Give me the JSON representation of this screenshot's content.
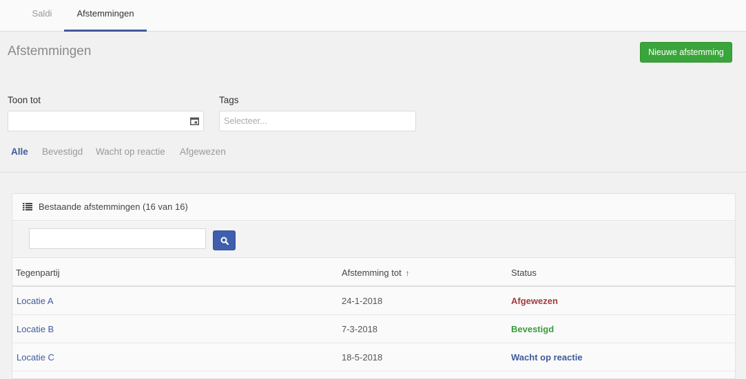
{
  "tabs": [
    {
      "label": "Saldi",
      "active": false
    },
    {
      "label": "Afstemmingen",
      "active": true
    }
  ],
  "header": {
    "title": "Afstemmingen",
    "new_button_label": "Nieuwe afstemming",
    "accent_color": "#3f5a9c",
    "button_color": "#3aa53a"
  },
  "filters": {
    "toon_tot_label": "Toon tot",
    "toon_tot_value": "",
    "tags_label": "Tags",
    "tags_placeholder": "Selecteer...",
    "status_filters": [
      "Alle",
      "Bevestigd",
      "Wacht op reactie",
      "Afgewezen"
    ],
    "active_filter": "Alle"
  },
  "panel": {
    "icon": "list-icon",
    "title": "Bestaande afstemmingen (16 van 16)",
    "search_value": "",
    "search_icon": "search-icon"
  },
  "table": {
    "columns": [
      "Tegenpartij",
      "Afstemming tot",
      "Status"
    ],
    "sort_column": "Afstemming tot",
    "sort_direction": "ascending",
    "rows": [
      {
        "tegenpartij": "Locatie A",
        "afstemming_tot": "24-1-2018",
        "status": "Afgewezen",
        "status_color": "#a33c3c"
      },
      {
        "tegenpartij": "Locatie B",
        "afstemming_tot": "7-3-2018",
        "status": "Bevestigd",
        "status_color": "#3a9c3a"
      },
      {
        "tegenpartij": "Locatie C",
        "afstemming_tot": "18-5-2018",
        "status": "Wacht op reactie",
        "status_color": "#3f5a9c"
      }
    ]
  }
}
